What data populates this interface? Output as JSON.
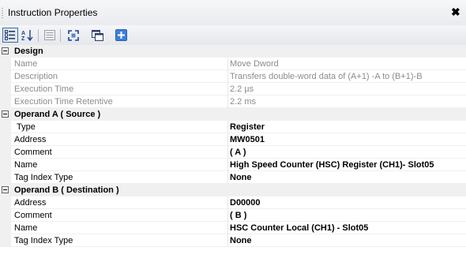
{
  "window": {
    "title": "Instruction Properties",
    "close_glyph": "✖"
  },
  "toolbar": {
    "buttons": [
      {
        "name": "categorized-view-icon",
        "active": true
      },
      {
        "name": "alphabetical-sort-icon",
        "label": "AZ"
      },
      {
        "name": "property-pages-icon"
      },
      {
        "name": "expand-all-icon"
      },
      {
        "name": "properties-window-icon"
      },
      {
        "name": "add-icon"
      }
    ]
  },
  "grid": {
    "sections": [
      {
        "title": "Design",
        "rows": [
          {
            "name": "Name",
            "value": "Move Dword",
            "readonly": true
          },
          {
            "name": "Description",
            "value": "Transfers double-word data of (A+1) -A to (B+1)-B",
            "readonly": true
          },
          {
            "name": "Execution Time",
            "value": "2.2 µs",
            "readonly": true
          },
          {
            "name": "Execution Time Retentive",
            "value": "2.2 ms",
            "readonly": true
          }
        ]
      },
      {
        "title": "Operand A ( Source )",
        "rows": [
          {
            "name": "Type",
            "value": "Register",
            "bold": true
          },
          {
            "name": "Address",
            "value": "MW0501",
            "bold": true
          },
          {
            "name": "Comment",
            "value": "( A )",
            "bold": true
          },
          {
            "name": "Name",
            "value": "High Speed Counter (HSC) Register (CH1)- Slot05",
            "bold": true
          },
          {
            "name": "Tag Index Type",
            "value": "None",
            "bold": true
          }
        ]
      },
      {
        "title": "Operand B ( Destination )",
        "rows": [
          {
            "name": "Address",
            "value": "D00000",
            "bold": true
          },
          {
            "name": "Comment",
            "value": "( B )",
            "bold": true
          },
          {
            "name": "Name",
            "value": "HSC Counter Local (CH1) - Slot05",
            "bold": true
          },
          {
            "name": "Tag Index Type",
            "value": "None",
            "bold": true
          }
        ]
      }
    ]
  }
}
